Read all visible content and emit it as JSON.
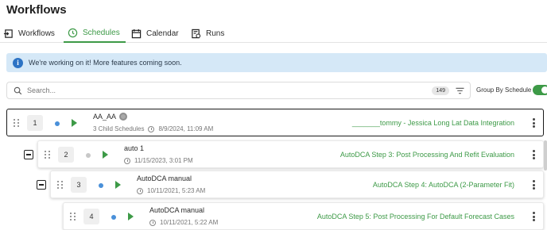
{
  "page": {
    "title": "Workflows"
  },
  "tabs": [
    {
      "label": "Workflows",
      "icon": "workflow-enter-icon"
    },
    {
      "label": "Schedules",
      "icon": "clock-icon",
      "active": true
    },
    {
      "label": "Calendar",
      "icon": "calendar-icon"
    },
    {
      "label": "Runs",
      "icon": "runs-icon"
    }
  ],
  "banner": {
    "text": "We're working on it! More features coming soon.",
    "icon": "info-icon",
    "color": "#d5e8f7"
  },
  "search": {
    "placeholder": "Search...",
    "count": "149",
    "filter_icon": "filter-icon"
  },
  "group_toggle": {
    "label": "Group By Schedule",
    "on": true
  },
  "accent": "#3d9a47",
  "schedules": [
    {
      "index": "1",
      "name": "AA_AA",
      "sub": "3 Child Schedules",
      "date": "8/9/2024, 11:09 AM",
      "workflow": "_______tommy - Jessica Long Lat Data Integration",
      "status_dot": "blue",
      "selected": true
    },
    {
      "index": "2",
      "name": "auto 1",
      "sub": "",
      "date": "11/15/2023, 3:01 PM",
      "workflow": "AutoDCA Step 3: Post Processing And Refit Evaluation",
      "status_dot": "grey"
    },
    {
      "index": "3",
      "name": "AutoDCA manual",
      "sub": "",
      "date": "10/11/2021, 5:23 AM",
      "workflow": "AutoDCA Step 4: AutoDCA (2-Parameter Fit)",
      "status_dot": "blue"
    },
    {
      "index": "4",
      "name": "AutoDCA manual",
      "sub": "",
      "date": "10/11/2021, 5:22 AM",
      "workflow": "AutoDCA Step 5: Post Processing For Default Forecast Cases",
      "status_dot": "blue"
    }
  ]
}
